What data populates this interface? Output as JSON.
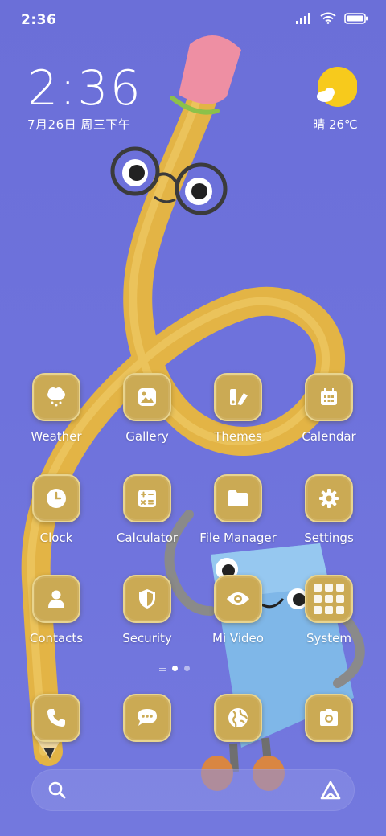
{
  "status_bar": {
    "time": "2:36",
    "icons": [
      "signal-icon",
      "wifi-icon",
      "battery-icon"
    ]
  },
  "clock_widget": {
    "time": "2:36",
    "date": "7月26日 周三下午"
  },
  "weather_widget": {
    "condition_icon": "partly-sunny-icon",
    "text": "晴 26℃"
  },
  "apps": [
    {
      "label": "Weather",
      "icon": "cloud-rain-icon"
    },
    {
      "label": "Gallery",
      "icon": "image-icon"
    },
    {
      "label": "Themes",
      "icon": "themes-icon"
    },
    {
      "label": "Calendar",
      "icon": "calendar-icon"
    },
    {
      "label": "Clock",
      "icon": "clock-icon"
    },
    {
      "label": "Calculator",
      "icon": "calculator-icon"
    },
    {
      "label": "File Manager",
      "icon": "folder-icon"
    },
    {
      "label": "Settings",
      "icon": "gear-icon"
    },
    {
      "label": "Contacts",
      "icon": "person-icon"
    },
    {
      "label": "Security",
      "icon": "shield-icon"
    },
    {
      "label": "Mi Video",
      "icon": "eye-icon"
    },
    {
      "label": "System",
      "icon": "folder-grid-icon"
    }
  ],
  "page_indicator": {
    "current_page": 1,
    "page_count": 2
  },
  "dock": [
    {
      "name": "phone",
      "icon": "phone-icon"
    },
    {
      "name": "messages",
      "icon": "chat-icon"
    },
    {
      "name": "browser",
      "icon": "globe-icon"
    },
    {
      "name": "camera",
      "icon": "camera-icon"
    }
  ],
  "search_bar": {
    "left_icon": "search-icon",
    "right_icon": "assistant-icon"
  },
  "colors": {
    "wallpaper": "#6e72dc",
    "icon_bg": "#cbaa54",
    "icon_border": "#e8d48f",
    "pencil": "#e9be4f"
  }
}
